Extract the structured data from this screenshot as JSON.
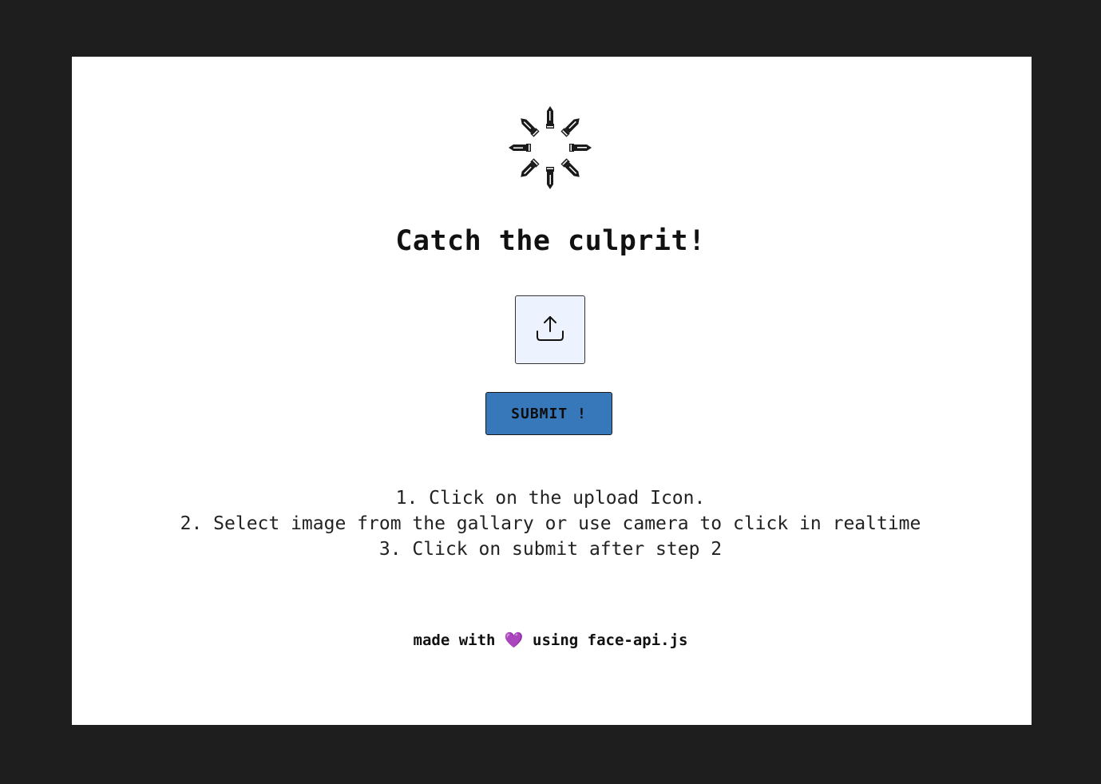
{
  "header": {
    "logo_icon": "bullet-ring-logo-icon",
    "title": "Catch the culprit!"
  },
  "upload": {
    "icon": "upload-icon"
  },
  "submit": {
    "label": "SUBMIT !",
    "color": "#3778bb"
  },
  "instructions": [
    "1. Click on the upload Icon.",
    "2. Select image from the gallary or use camera to click in realtime",
    "3. Click on submit after step 2"
  ],
  "footer": {
    "prefix": "made with",
    "heart": "💜",
    "suffix": "using face-api.js"
  }
}
